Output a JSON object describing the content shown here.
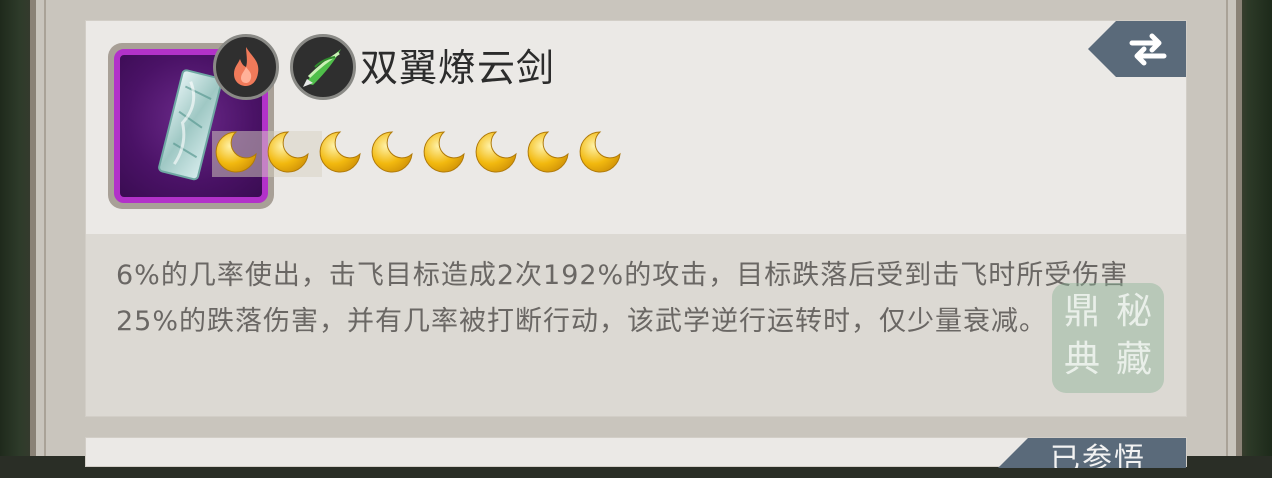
{
  "skill": {
    "name": "双翼燎云剑",
    "rank_moons": 8,
    "element_badges": [
      {
        "icon": "fire-icon"
      },
      {
        "icon": "wind-blade-icon"
      }
    ],
    "item_icon": "jade-token-icon",
    "description": "6%的几率使出，击飞目标造成2次192%的攻击，目标跌落后受到击飞时所受伤害25%的跌落伤害，并有几率被打断行动，该武学逆行运转时，仅少量衰减。",
    "swap_icon": "swap-arrows-icon",
    "seal_chars": [
      "秘",
      "藏",
      "鼎",
      "典"
    ]
  },
  "next_card": {
    "label": "已参悟"
  },
  "colors": {
    "card_bg": "#ebe9e6",
    "desc_bg": "#dcd9d3",
    "item_border": "#b232c9",
    "tab_bg": "#5a6a7a",
    "moon_gold": "#f2b90f"
  }
}
